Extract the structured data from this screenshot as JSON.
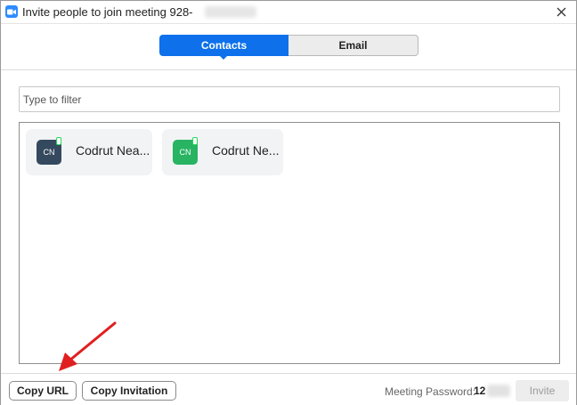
{
  "window": {
    "title": "Invite people to join meeting 928-",
    "close_icon": "close-icon",
    "app_icon": "zoom-camera-icon"
  },
  "tabs": [
    {
      "label": "Contacts",
      "active": true
    },
    {
      "label": "Email",
      "active": false
    }
  ],
  "filter": {
    "placeholder": "Type to filter",
    "value": ""
  },
  "contacts": [
    {
      "initials": "CN",
      "name": "Codrut Nea...",
      "avatar_color": "#34495e",
      "status_color": "#23d959"
    },
    {
      "initials": "CN",
      "name": "Codrut Ne...",
      "avatar_color": "#28b463",
      "status_color": "#23d959"
    }
  ],
  "footer": {
    "copy_url_label": "Copy URL",
    "copy_invitation_label": "Copy Invitation",
    "password_label": "Meeting Password:",
    "password_value": "12",
    "invite_label": "Invite"
  },
  "colors": {
    "accent": "#0e71eb",
    "annotation_arrow": "#e02020"
  }
}
